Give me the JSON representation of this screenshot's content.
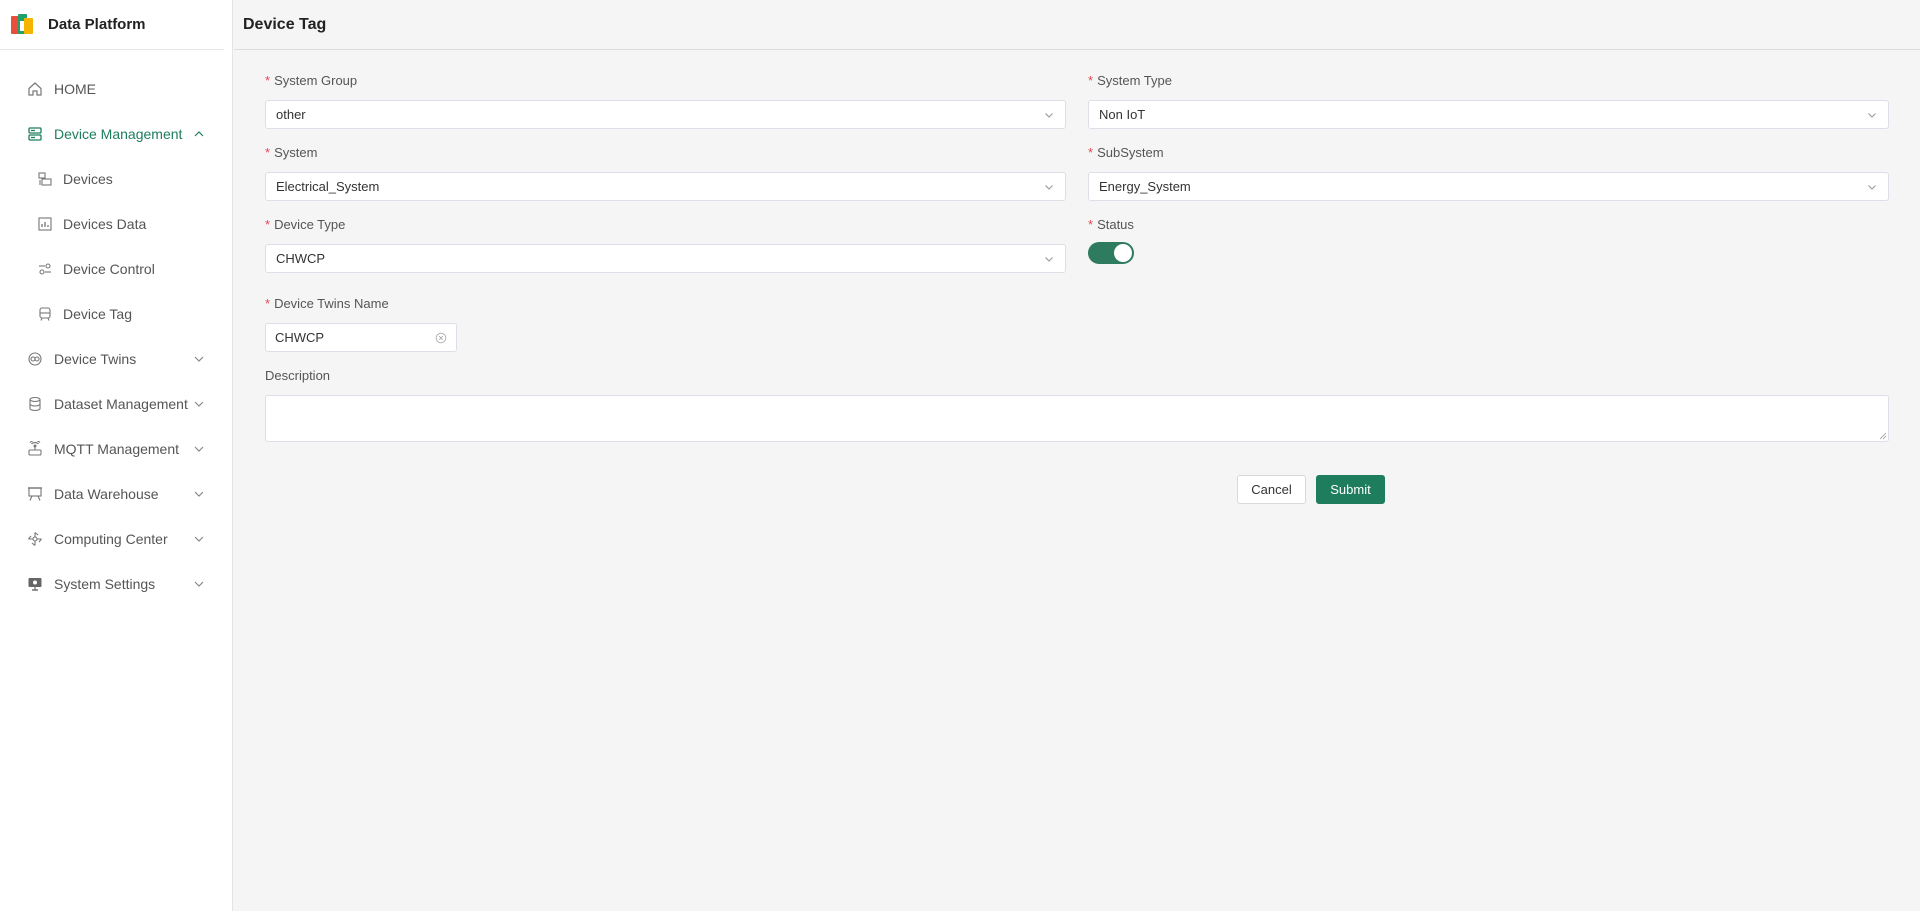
{
  "app": {
    "title": "Data Platform"
  },
  "page": {
    "title": "Device Tag"
  },
  "sidebar": {
    "items": [
      {
        "label": "HOME",
        "icon": "home-icon"
      },
      {
        "label": "Device Management",
        "icon": "device-management-icon",
        "expanded": true
      },
      {
        "label": "Devices",
        "icon": "devices-icon"
      },
      {
        "label": "Devices Data",
        "icon": "devices-data-icon"
      },
      {
        "label": "Device Control",
        "icon": "device-control-icon"
      },
      {
        "label": "Device Tag",
        "icon": "device-tag-icon"
      },
      {
        "label": "Device Twins",
        "icon": "device-twins-icon"
      },
      {
        "label": "Dataset Management",
        "icon": "database-icon"
      },
      {
        "label": "MQTT Management",
        "icon": "mqtt-icon"
      },
      {
        "label": "Data Warehouse",
        "icon": "warehouse-icon"
      },
      {
        "label": "Computing Center",
        "icon": "computing-icon"
      },
      {
        "label": "System Settings",
        "icon": "monitor-settings-icon"
      }
    ]
  },
  "form": {
    "system_group": {
      "label": "System Group",
      "value": "other"
    },
    "system_type": {
      "label": "System Type",
      "value": "Non IoT"
    },
    "system": {
      "label": "System",
      "value": "Electrical_System"
    },
    "subsystem": {
      "label": "SubSystem",
      "value": "Energy_System"
    },
    "device_type": {
      "label": "Device Type",
      "value": "CHWCP"
    },
    "status": {
      "label": "Status",
      "on": true
    },
    "device_twins_name": {
      "label": "Device Twins Name",
      "value": "CHWCP"
    },
    "description": {
      "label": "Description",
      "value": ""
    },
    "required_mark": "*"
  },
  "buttons": {
    "cancel": "Cancel",
    "submit": "Submit"
  },
  "colors": {
    "accent": "#1e7d5d",
    "required": "#e5484d",
    "toggle": "#2f7b5f"
  }
}
